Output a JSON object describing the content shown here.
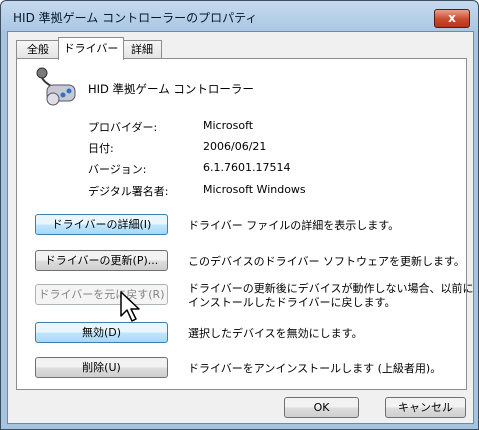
{
  "window": {
    "title": "HID 準拠ゲーム コントローラーのプロパティ",
    "close_glyph": "x"
  },
  "tabs": [
    {
      "label": "全般"
    },
    {
      "label": "ドライバー"
    },
    {
      "label": "詳細"
    }
  ],
  "device": {
    "name": "HID 準拠ゲーム コントローラー"
  },
  "info": [
    {
      "label": "プロバイダー:",
      "value": "Microsoft"
    },
    {
      "label": "日付:",
      "value": "2006/06/21"
    },
    {
      "label": "バージョン:",
      "value": "6.1.7601.17514"
    },
    {
      "label": "デジタル署名者:",
      "value": "Microsoft Windows"
    }
  ],
  "actions": [
    {
      "label": "ドライバーの詳細(I)",
      "description": "ドライバー ファイルの詳細を表示します。"
    },
    {
      "label": "ドライバーの更新(P)...",
      "description": "このデバイスのドライバー ソフトウェアを更新します。"
    },
    {
      "label": "ドライバーを元に戻す(R)",
      "description_line1": "ドライバーの更新後にデバイスが動作しない場合、以前に",
      "description_line2": "インストールしたドライバーに戻します。"
    },
    {
      "label": "無効(D)",
      "description": "選択したデバイスを無効にします。"
    },
    {
      "label": "削除(U)",
      "description": "ドライバーをアンインストールします (上級者用)。"
    }
  ],
  "footer": {
    "ok_label": "OK",
    "cancel_label": "キャンセル"
  }
}
